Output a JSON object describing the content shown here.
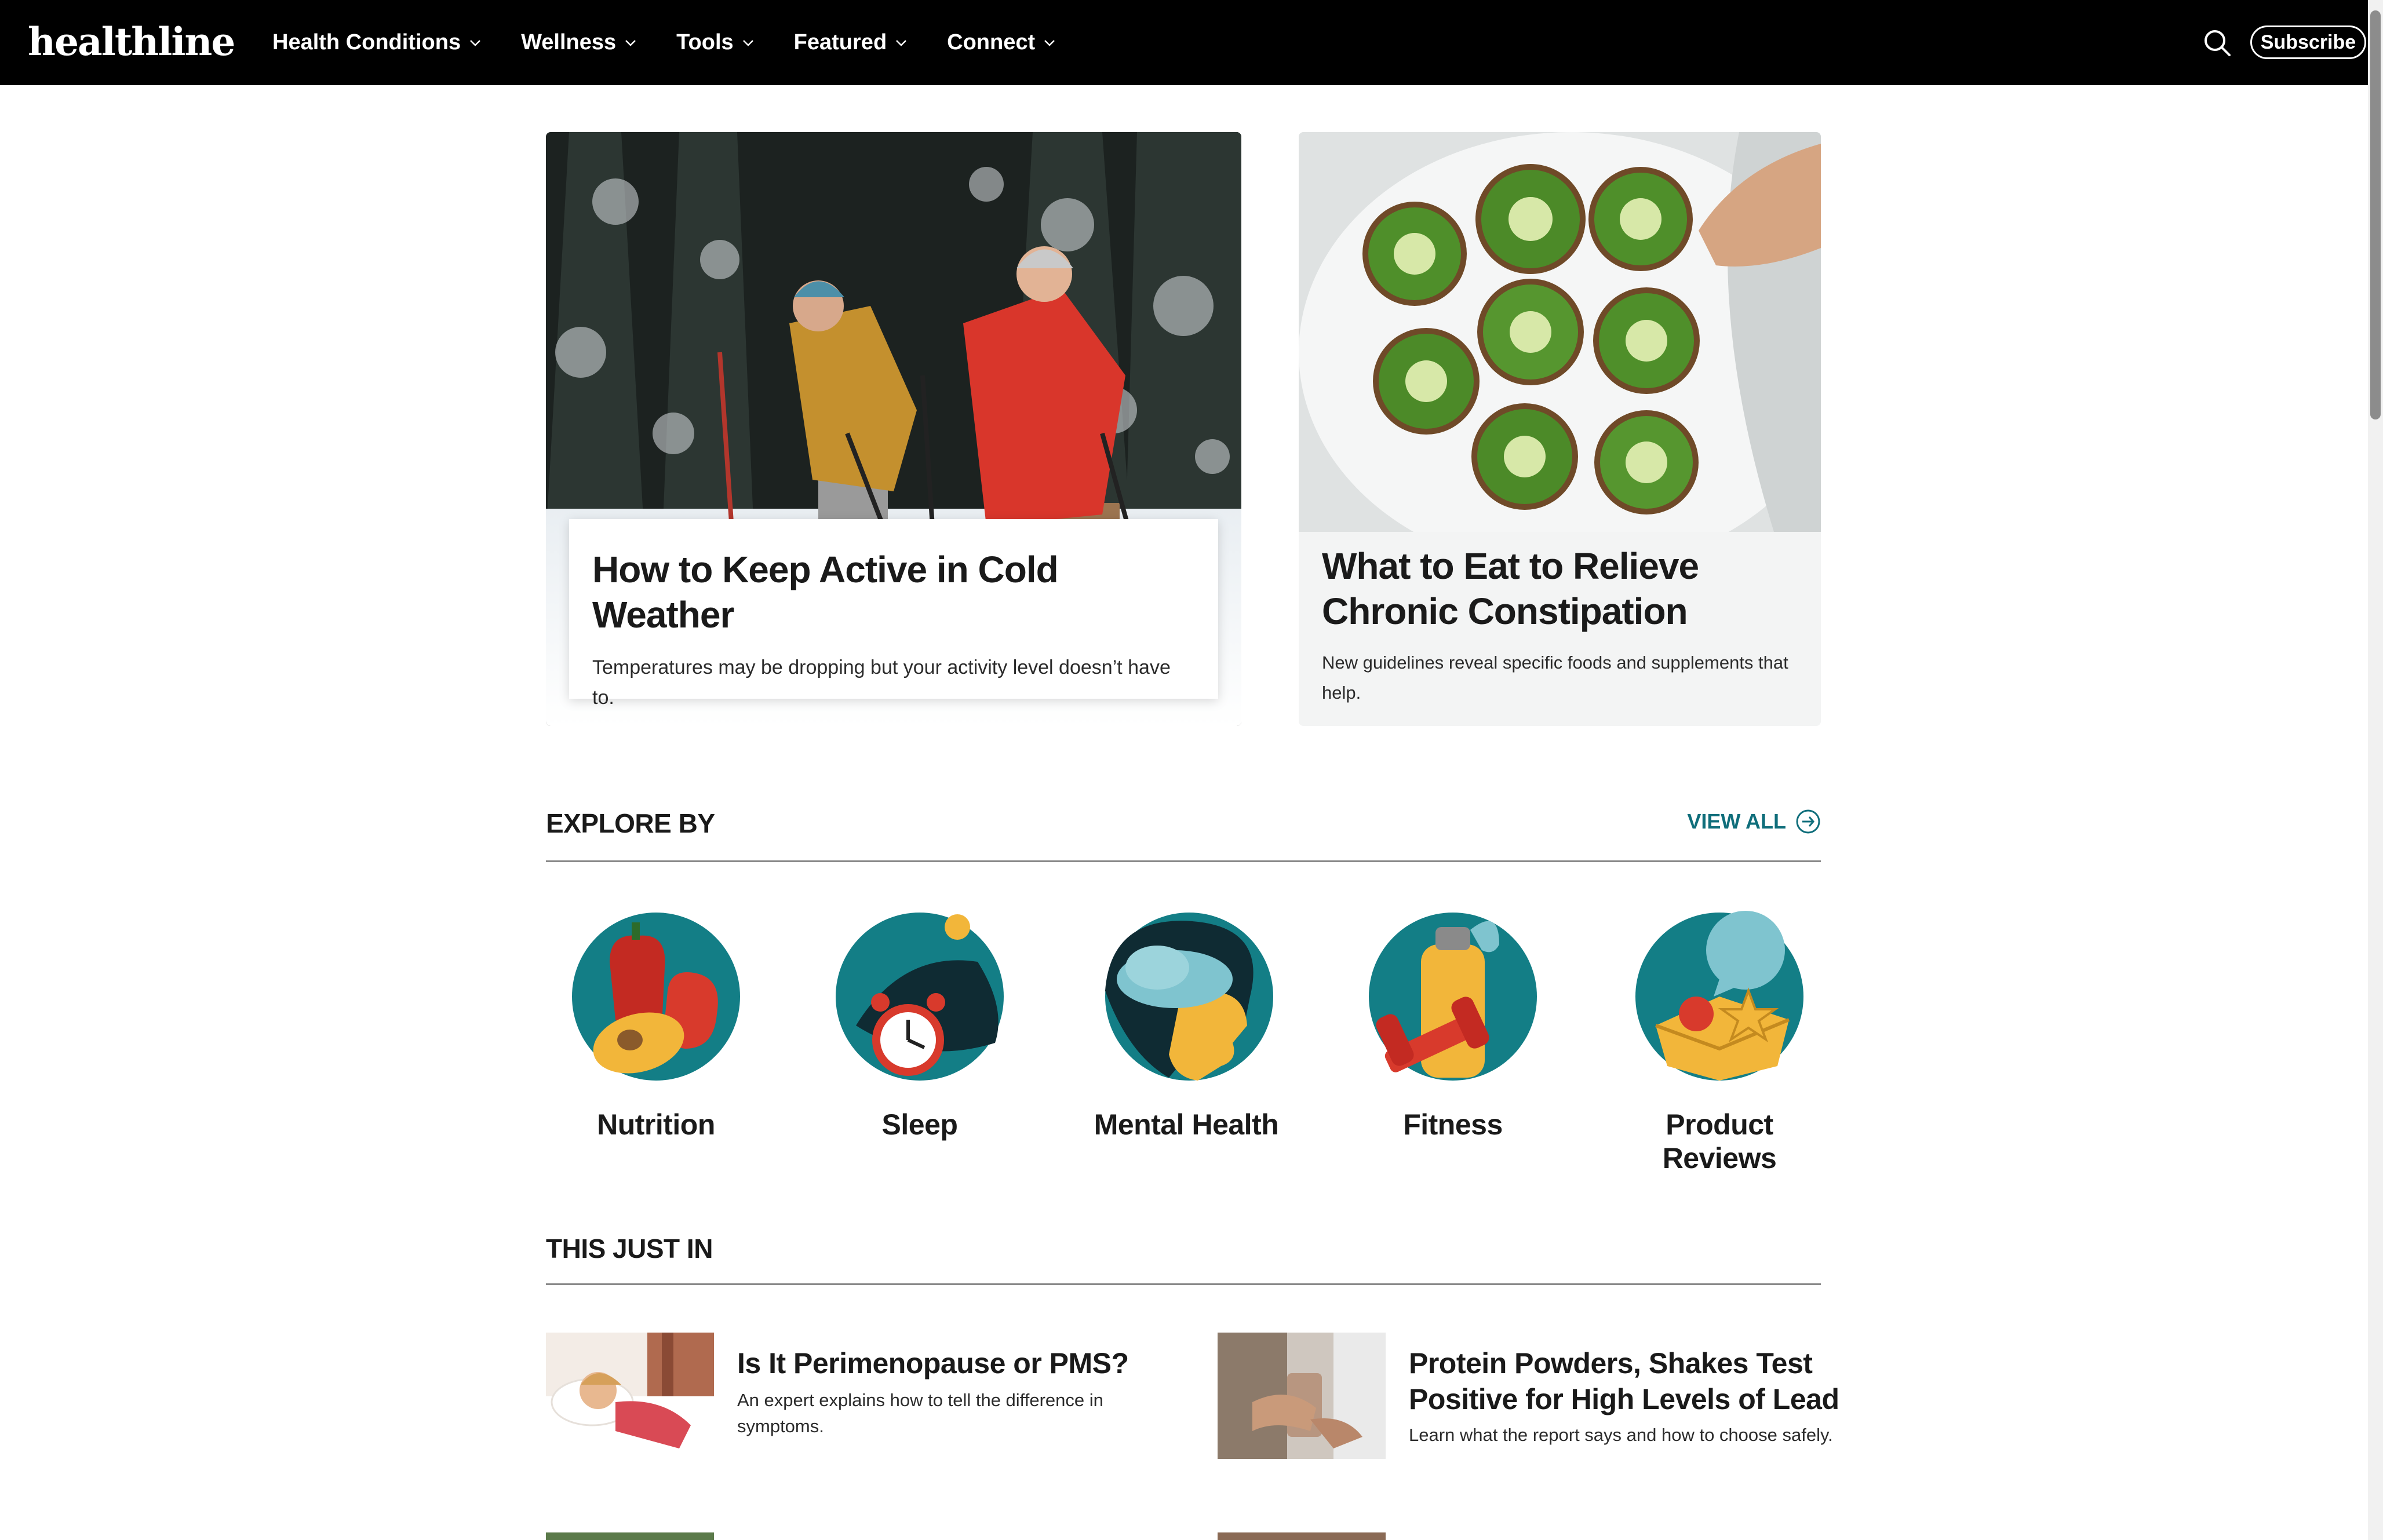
{
  "nav": {
    "logo": "healthline",
    "menu": [
      {
        "label": "Health Conditions"
      },
      {
        "label": "Wellness"
      },
      {
        "label": "Tools"
      },
      {
        "label": "Featured"
      },
      {
        "label": "Connect"
      }
    ],
    "search_icon": "search-icon",
    "subscribe_label": "Subscribe"
  },
  "hero": [
    {
      "title": "How to Keep Active in Cold Weather",
      "description": "Temperatures may be dropping but your activity level doesn’t have to."
    },
    {
      "title": "What to Eat to Relieve Chronic Constipation",
      "description": "New guidelines reveal specific foods and supplements that help."
    }
  ],
  "explore": {
    "title": "EXPLORE BY",
    "view_all": "VIEW ALL",
    "topics": [
      {
        "label": "Nutrition",
        "icon": "nutrition-icon"
      },
      {
        "label": "Sleep",
        "icon": "sleep-icon"
      },
      {
        "label": "Mental Health",
        "icon": "mental-health-icon"
      },
      {
        "label": "Fitness",
        "icon": "fitness-icon"
      },
      {
        "label": "Product Reviews",
        "icon": "product-reviews-icon"
      }
    ]
  },
  "just_in": {
    "title": "THIS JUST IN",
    "articles": [
      {
        "title": "Is It Perimenopause or PMS?",
        "description": "An expert explains how to tell the difference in symptoms."
      },
      {
        "title": "Protein Powders, Shakes Test Positive for High Levels of Lead",
        "description": "Learn what the report says and how to choose safely."
      }
    ]
  },
  "colors": {
    "nav_bg": "#000000",
    "accent_teal": "#0f6e7b",
    "icon_teal": "#137e86",
    "icon_yellow": "#f2b63a",
    "icon_red": "#d83a2c"
  }
}
